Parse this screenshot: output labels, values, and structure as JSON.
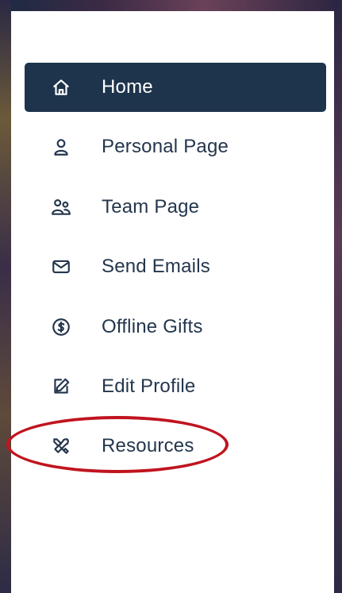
{
  "sidebar": {
    "items": [
      {
        "label": "Home",
        "icon": "home-icon",
        "active": true
      },
      {
        "label": "Personal Page",
        "icon": "user-icon",
        "active": false
      },
      {
        "label": "Team Page",
        "icon": "users-icon",
        "active": false
      },
      {
        "label": "Send Emails",
        "icon": "mail-icon",
        "active": false
      },
      {
        "label": "Offline Gifts",
        "icon": "dollar-circle-icon",
        "active": false
      },
      {
        "label": "Edit Profile",
        "icon": "edit-icon",
        "active": false
      },
      {
        "label": "Resources",
        "icon": "tools-icon",
        "active": false
      }
    ]
  },
  "colors": {
    "active_bg": "#1e344d",
    "text": "#24364d",
    "highlight": "#c0141f"
  }
}
